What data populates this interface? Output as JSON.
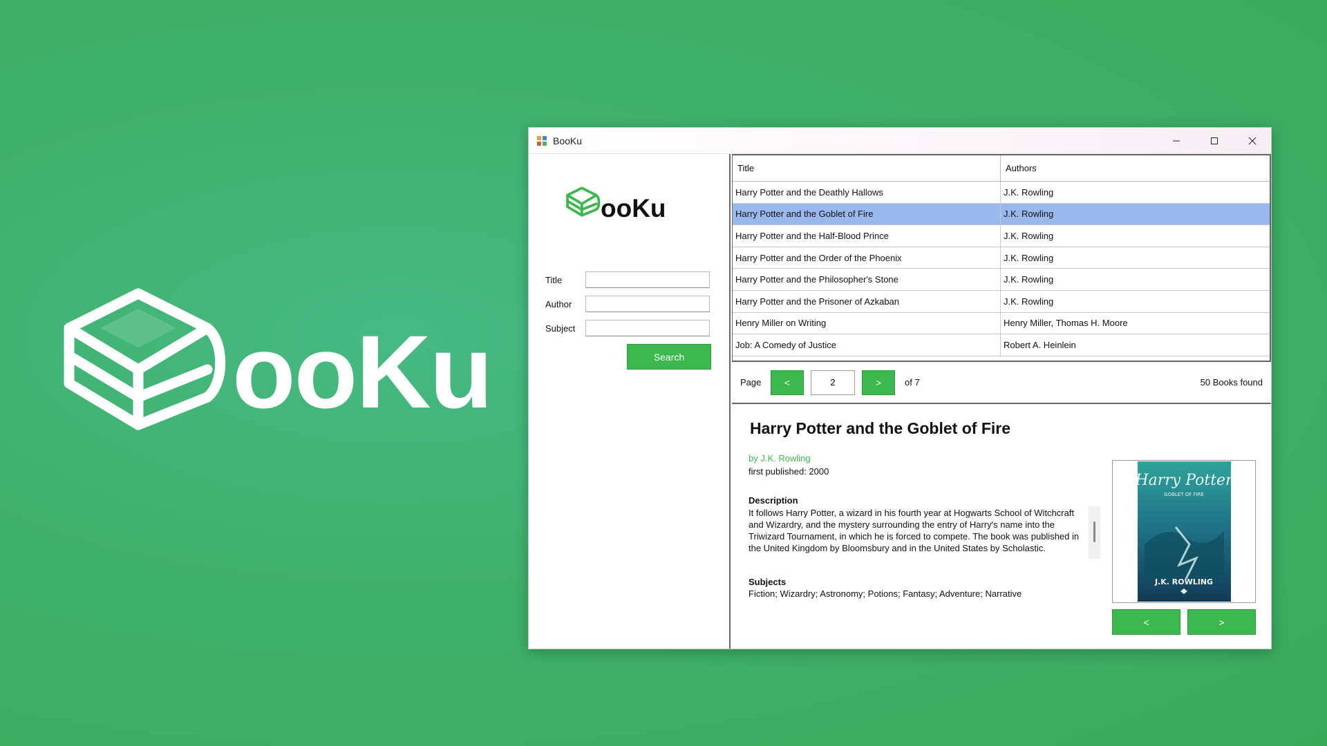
{
  "hero": {
    "logo_text": "ooKu"
  },
  "window": {
    "title": "BooKu",
    "controls": {
      "minimize": "minimize-icon",
      "maximize": "maximize-icon",
      "close": "close-icon"
    }
  },
  "sidebar": {
    "logo_text": "ooKu",
    "fields": [
      {
        "label": "Title",
        "value": "",
        "placeholder": ""
      },
      {
        "label": "Author",
        "value": "",
        "placeholder": ""
      },
      {
        "label": "Subject",
        "value": "",
        "placeholder": ""
      }
    ],
    "search_label": "Search"
  },
  "table": {
    "headers": [
      "Title",
      "Authors"
    ],
    "selected_index": 1,
    "rows": [
      {
        "title": "Harry Potter and the Deathly Hallows",
        "authors": "J.K. Rowling"
      },
      {
        "title": "Harry Potter and the Goblet of Fire",
        "authors": "J.K. Rowling"
      },
      {
        "title": "Harry Potter and the Half-Blood Prince",
        "authors": "J.K. Rowling"
      },
      {
        "title": "Harry Potter and the Order of the Phoenix",
        "authors": "J.K. Rowling"
      },
      {
        "title": "Harry Potter and the Philosopher's Stone",
        "authors": "J.K. Rowling"
      },
      {
        "title": "Harry Potter and the Prisoner of Azkaban",
        "authors": "J.K. Rowling"
      },
      {
        "title": "Henry Miller on Writing",
        "authors": "Henry Miller, Thomas H. Moore"
      },
      {
        "title": "Job: A Comedy of Justice",
        "authors": "Robert A. Heinlein"
      }
    ]
  },
  "pager": {
    "page_label": "Page",
    "prev_label": "<",
    "next_label": ">",
    "current_page": "2",
    "of_label": "of 7",
    "found_label": "50 Books found"
  },
  "detail": {
    "title": "Harry Potter and the Goblet of Fire",
    "author_line": "by J.K. Rowling",
    "published_line": "first published: 2000",
    "description_heading": "Description",
    "description": "It follows Harry Potter, a wizard in his fourth year at Hogwarts School of Witchcraft and Wizardry, and the mystery surrounding the entry of Harry's name into the Triwizard Tournament, in which he is forced to compete. The book was published in the United Kingdom by Bloomsbury and in the United States by Scholastic.",
    "subjects_heading": "Subjects",
    "subjects": "Fiction; Wizardry; Astronomy; Potions; Fantasy; Adventure; Narrative",
    "cover": {
      "title_top": "Harry Potter",
      "title_sub": "GOBLET OF FIRE",
      "author": "J.K. ROWLING"
    },
    "cover_prev_label": "<",
    "cover_next_label": ">"
  },
  "colors": {
    "accent": "#3db84f",
    "selection": "#99b8ed",
    "background": "#3fb06a"
  }
}
